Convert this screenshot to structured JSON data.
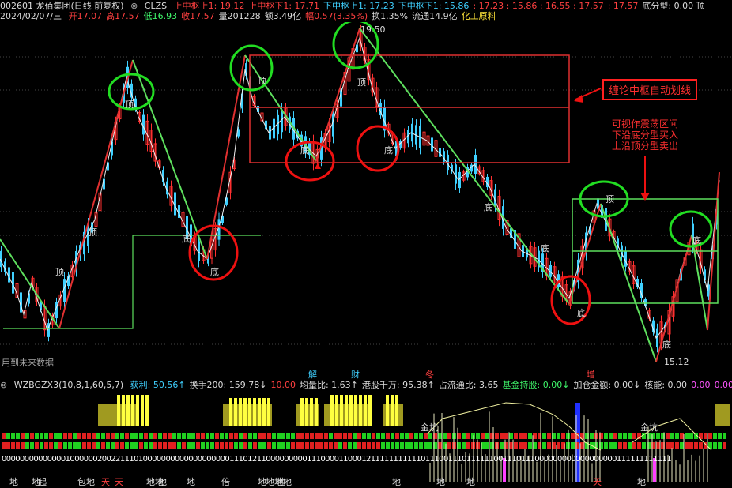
{
  "header": {
    "code_name": "002601 龙佰集团(日线 前复权)",
    "formula_name": "CLZS",
    "items": [
      {
        "text": "上中枢上1: 19.12",
        "color": "#ff4040"
      },
      {
        "text": "上中枢下1: 17.71",
        "color": "#ff4040"
      },
      {
        "text": "下中枢上1: 17.23",
        "color": "#3fd0ff"
      },
      {
        "text": "下中枢下1: 15.86",
        "color": "#3fd0ff"
      },
      {
        "text": ": 17.23 : 15.86 : 16.55 : 17.57",
        "color": "#ff4040"
      },
      {
        "text": ": 17.57",
        "color": "#ff4040"
      },
      {
        "text": "底分型: 0.00 顶",
        "color": "#dcdcdc"
      }
    ],
    "date": "2024/02/07/三",
    "ohlc": [
      {
        "text": "开17.07",
        "color": "#ff4040"
      },
      {
        "text": "高17.57",
        "color": "#ff4040"
      },
      {
        "text": "低16.93",
        "color": "#3ff56a"
      },
      {
        "text": "收17.57",
        "color": "#ff4040"
      },
      {
        "text": "量201228",
        "color": "#dcdcdc"
      },
      {
        "text": "额3.49亿",
        "color": "#dcdcdc"
      },
      {
        "text": "幅0.57(3.35%)",
        "color": "#ff4040"
      },
      {
        "text": "换1.35%",
        "color": "#dcdcdc"
      },
      {
        "text": "流通14.9亿",
        "color": "#dcdcdc"
      },
      {
        "text": "化工原料",
        "color": "#ffe43a"
      }
    ]
  },
  "main_chart": {
    "high_label": "19.50",
    "low_label": "15.12",
    "future_data_label": "用到未来数据",
    "pivot_labels": [
      "顶",
      "顶",
      "顶",
      "底",
      "底",
      "底",
      "底",
      "底",
      "底",
      "顶",
      "顶",
      "底",
      "底",
      "顶",
      "底"
    ],
    "annotation_box": "缠论中枢自动划线",
    "annotation_text": "可视作震荡区间 下沿底分型买入 上沿顶分型卖出"
  },
  "indicator": {
    "name": "WZBGZX3(10,8,1,60,5,7)",
    "items": [
      {
        "text": "获利: 50.56↑",
        "color": "#3fd0ff"
      },
      {
        "text": "换手200: 159.78↓",
        "color": "#dcdcdc"
      },
      {
        "text": "10.00",
        "color": "#ff4040"
      },
      {
        "text": "均量比: 1.63↑",
        "color": "#dcdcdc"
      },
      {
        "text": "港股千万: 95.38↑",
        "color": "#dcdcdc"
      },
      {
        "text": "占流通比: 3.65",
        "color": "#dcdcdc"
      },
      {
        "text": "基金持股: 0.00↓",
        "color": "#3ff56a"
      },
      {
        "text": "加仓金额: 0.00↓",
        "color": "#dcdcdc"
      },
      {
        "text": "核能: 0.00",
        "color": "#dcdcdc"
      },
      {
        "text": "0.00",
        "color": "#ff55ff"
      },
      {
        "text": "0.00",
        "color": "#ff55ff"
      }
    ],
    "top_marks": [
      {
        "text": "解",
        "color": "#3fd0ff"
      },
      {
        "text": "财",
        "color": "#3fd0ff"
      },
      {
        "text": "冬",
        "color": "#ff4040"
      },
      {
        "text": "增",
        "color": "#ff4040"
      }
    ],
    "jinkeng_label": "金坑",
    "binary_string": "000000000000001000000200221110100000000000000000001110121100000000011100001100012111111111110111001110111111001110111000000000000000000111111111111",
    "bottom_words": [
      {
        "text": "地",
        "color": "#dcdcdc"
      },
      {
        "text": "地",
        "color": "#dcdcdc"
      },
      {
        "text": "起",
        "color": "#dcdcdc"
      },
      {
        "text": "包地",
        "color": "#dcdcdc"
      },
      {
        "text": "天",
        "color": "#ff4040"
      },
      {
        "text": "天",
        "color": "#ff4040"
      },
      {
        "text": "地地",
        "color": "#dcdcdc"
      },
      {
        "text": "地",
        "color": "#dcdcdc"
      },
      {
        "text": "地",
        "color": "#dcdcdc"
      },
      {
        "text": "倍",
        "color": "#dcdcdc"
      },
      {
        "text": "地",
        "color": "#dcdcdc"
      },
      {
        "text": "地地地",
        "color": "#dcdcdc"
      },
      {
        "text": "地",
        "color": "#dcdcdc"
      },
      {
        "text": "地",
        "color": "#dcdcdc"
      },
      {
        "text": "地",
        "color": "#dcdcdc"
      },
      {
        "text": "地",
        "color": "#dcdcdc"
      },
      {
        "text": "天",
        "color": "#ff4040"
      },
      {
        "text": "地",
        "color": "#dcdcdc"
      }
    ]
  },
  "colors": {
    "background": "#000000",
    "up": "#ff3030",
    "down": "#3fd0ff",
    "zigzag_green": "#5ee05e",
    "zigzag_red": "#e03030",
    "circle_green": "#22dd22",
    "circle_red": "#ee1111"
  }
}
